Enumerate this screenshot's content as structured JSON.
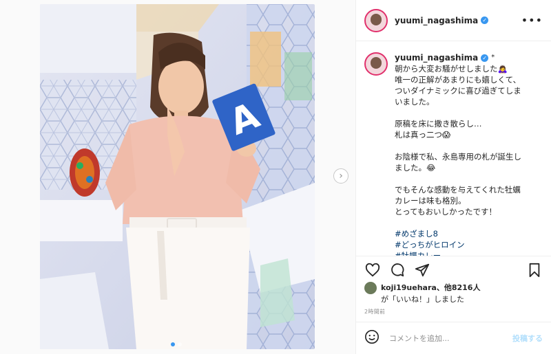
{
  "post": {
    "username": "yuumi_nagashima",
    "verified_mark": "✓",
    "more_icon": "•••",
    "bullet": "*"
  },
  "caption": {
    "username": "yuumi_nagashima",
    "lines": [
      "朝から大変お騒がせしました🙇‍♀️",
      "唯一の正解があまりにも嬉しくて、",
      "ついダイナミックに喜び過ぎてしま",
      "いました。",
      "",
      "原稿を床に撒き散らし…",
      "札は真っ二つ😱",
      "",
      "お陰様で私、永島専用の札が誕生し",
      "ました。😂",
      "",
      "でもそんな感動を与えてくれた牡蠣",
      "カレーは味も格別。",
      "とってもおいしかったです！"
    ],
    "hashtags": [
      "#めざまし8",
      "#どっちがヒロイン",
      "#牡蠣カレー"
    ]
  },
  "photo": {
    "card_letter": "A"
  },
  "likes": {
    "liker": "koji19uehara",
    "others": "、他8216人",
    "suffix": "が「いいね！」しました"
  },
  "time": "2時間前",
  "comment": {
    "placeholder": "コメントを追加...",
    "post_label": "投稿する"
  },
  "icons": {
    "like": "heart-icon",
    "comment": "comment-icon",
    "share": "paper-plane-icon",
    "save": "bookmark-icon",
    "emoji": "emoji-icon",
    "next": "chevron-right-icon"
  },
  "carousel": {
    "count": 2,
    "active_index": 0
  },
  "colors": {
    "link": "#00376b",
    "verified": "#3897f0",
    "post_btn": "#b2dffc",
    "card": "#2f64c7"
  }
}
